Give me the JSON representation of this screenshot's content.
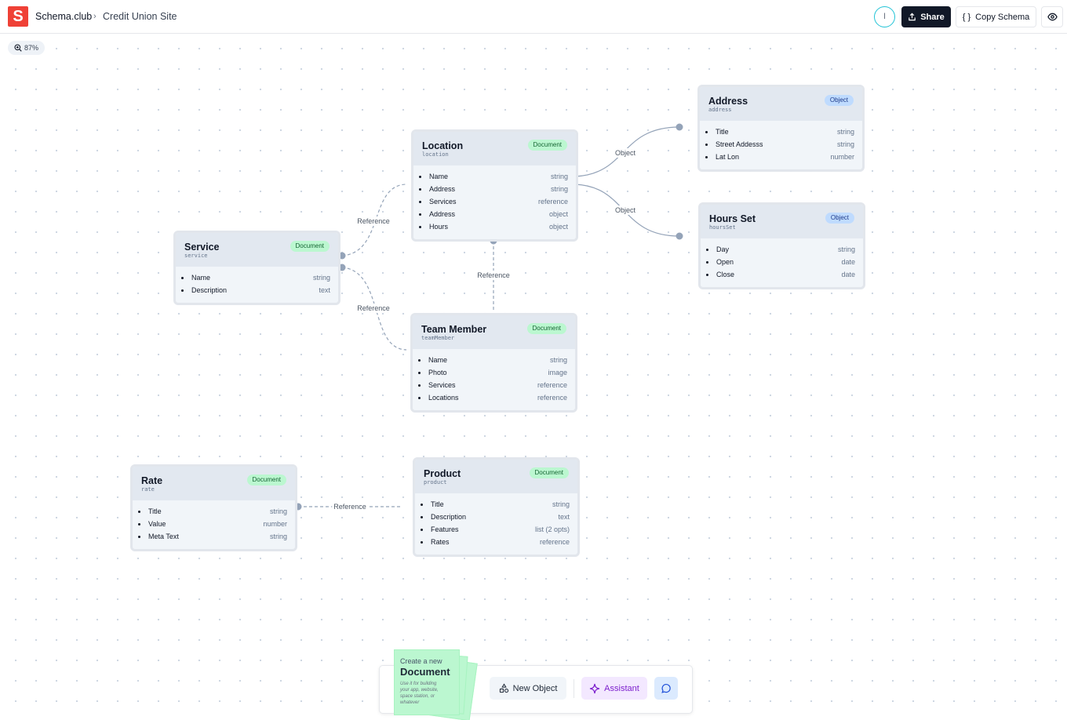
{
  "app": {
    "logo_letter": "S",
    "brand_color": "#ef4136",
    "breadcrumb": {
      "app_name": "Schema.club",
      "separator": "›",
      "page_name": "Credit Union Site"
    }
  },
  "header": {
    "avatar_initial": "I",
    "share_label": "Share",
    "copy_schema_label": "Copy Schema",
    "copy_schema_icon": "{ }",
    "preview_icon": "eye-icon"
  },
  "canvas": {
    "zoom_level": "87%"
  },
  "nodes": {
    "location": {
      "title": "Location",
      "key": "location",
      "badge": "Document",
      "fields": [
        {
          "name": "Name",
          "type": "string"
        },
        {
          "name": "Address",
          "type": "string"
        },
        {
          "name": "Services",
          "type": "reference"
        },
        {
          "name": "Address",
          "type": "object"
        },
        {
          "name": "Hours",
          "type": "object"
        }
      ]
    },
    "address": {
      "title": "Address",
      "key": "address",
      "badge": "Object",
      "fields": [
        {
          "name": "Title",
          "type": "string"
        },
        {
          "name": "Street Addesss",
          "type": "string"
        },
        {
          "name": "Lat Lon",
          "type": "number"
        }
      ]
    },
    "hours_set": {
      "title": "Hours Set",
      "key": "hoursSet",
      "badge": "Object",
      "fields": [
        {
          "name": "Day",
          "type": "string"
        },
        {
          "name": "Open",
          "type": "date"
        },
        {
          "name": "Close",
          "type": "date"
        }
      ]
    },
    "service": {
      "title": "Service",
      "key": "service",
      "badge": "Document",
      "fields": [
        {
          "name": "Name",
          "type": "string"
        },
        {
          "name": "Description",
          "type": "text"
        }
      ]
    },
    "team_member": {
      "title": "Team Member",
      "key": "teamMember",
      "badge": "Document",
      "fields": [
        {
          "name": "Name",
          "type": "string"
        },
        {
          "name": "Photo",
          "type": "image"
        },
        {
          "name": "Services",
          "type": "reference"
        },
        {
          "name": "Locations",
          "type": "reference"
        }
      ]
    },
    "rate": {
      "title": "Rate",
      "key": "rate",
      "badge": "Document",
      "fields": [
        {
          "name": "Title",
          "type": "string"
        },
        {
          "name": "Value",
          "type": "number"
        },
        {
          "name": "Meta Text",
          "type": "string"
        }
      ]
    },
    "product": {
      "title": "Product",
      "key": "product",
      "badge": "Document",
      "fields": [
        {
          "name": "Title",
          "type": "string"
        },
        {
          "name": "Description",
          "type": "text"
        },
        {
          "name": "Features",
          "type": "list (2 opts)"
        },
        {
          "name": "Rates",
          "type": "reference"
        }
      ]
    }
  },
  "edges": [
    {
      "from": "location",
      "to": "address",
      "label": "Object"
    },
    {
      "from": "location",
      "to": "hours_set",
      "label": "Object"
    },
    {
      "from": "service",
      "to": "location",
      "label": "Reference"
    },
    {
      "from": "service",
      "to": "team_member",
      "label": "Reference"
    },
    {
      "from": "location",
      "to": "team_member",
      "label": "Reference"
    },
    {
      "from": "rate",
      "to": "product",
      "label": "Reference"
    }
  ],
  "toolbar": {
    "create_doc": {
      "small_label": "Create a new",
      "big_label": "Document",
      "description": "Use it for building your app, website, space station, or whatever"
    },
    "new_object_label": "New Object",
    "assistant_label": "Assistant",
    "chat_icon": "chat-bubble-icon"
  },
  "colors": {
    "document_badge_bg": "#bbf7d0",
    "object_badge_bg": "#bfdbfe",
    "assistant_accent": "#7e22ce",
    "edge_color": "#94a3b8"
  }
}
